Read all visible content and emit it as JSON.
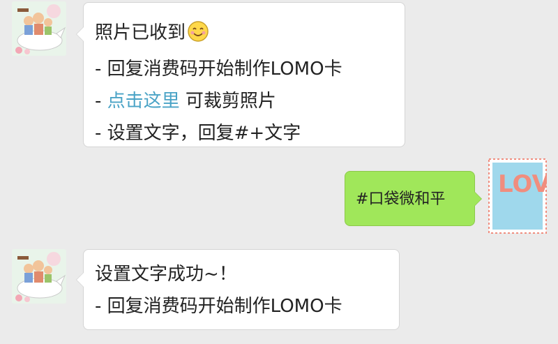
{
  "colors": {
    "background": "#ebebeb",
    "incoming_bubble": "#ffffff",
    "outgoing_bubble": "#a0e75a",
    "link": "#4aa3c6"
  },
  "messages": [
    {
      "direction": "incoming",
      "avatar_icon": "cartoon-family-on-bird-icon",
      "lines": {
        "l1": "照片已收到",
        "l1_emoji": "smiling-face-icon",
        "l2": "- 回复消费码开始制作LOMO卡",
        "l3_prefix": "- ",
        "l3_link": "点击这里",
        "l3_suffix": " 可裁剪照片",
        "l4": "- 设置文字，回复#+文字"
      }
    },
    {
      "direction": "outgoing",
      "avatar_icon": "love-stamp-icon",
      "avatar_text": "LOVE",
      "text": "#口袋微和平"
    },
    {
      "direction": "incoming",
      "avatar_icon": "cartoon-family-on-bird-icon",
      "lines": {
        "l1": "设置文字成功~！",
        "l2": "- 回复消费码开始制作LOMO卡"
      }
    }
  ]
}
